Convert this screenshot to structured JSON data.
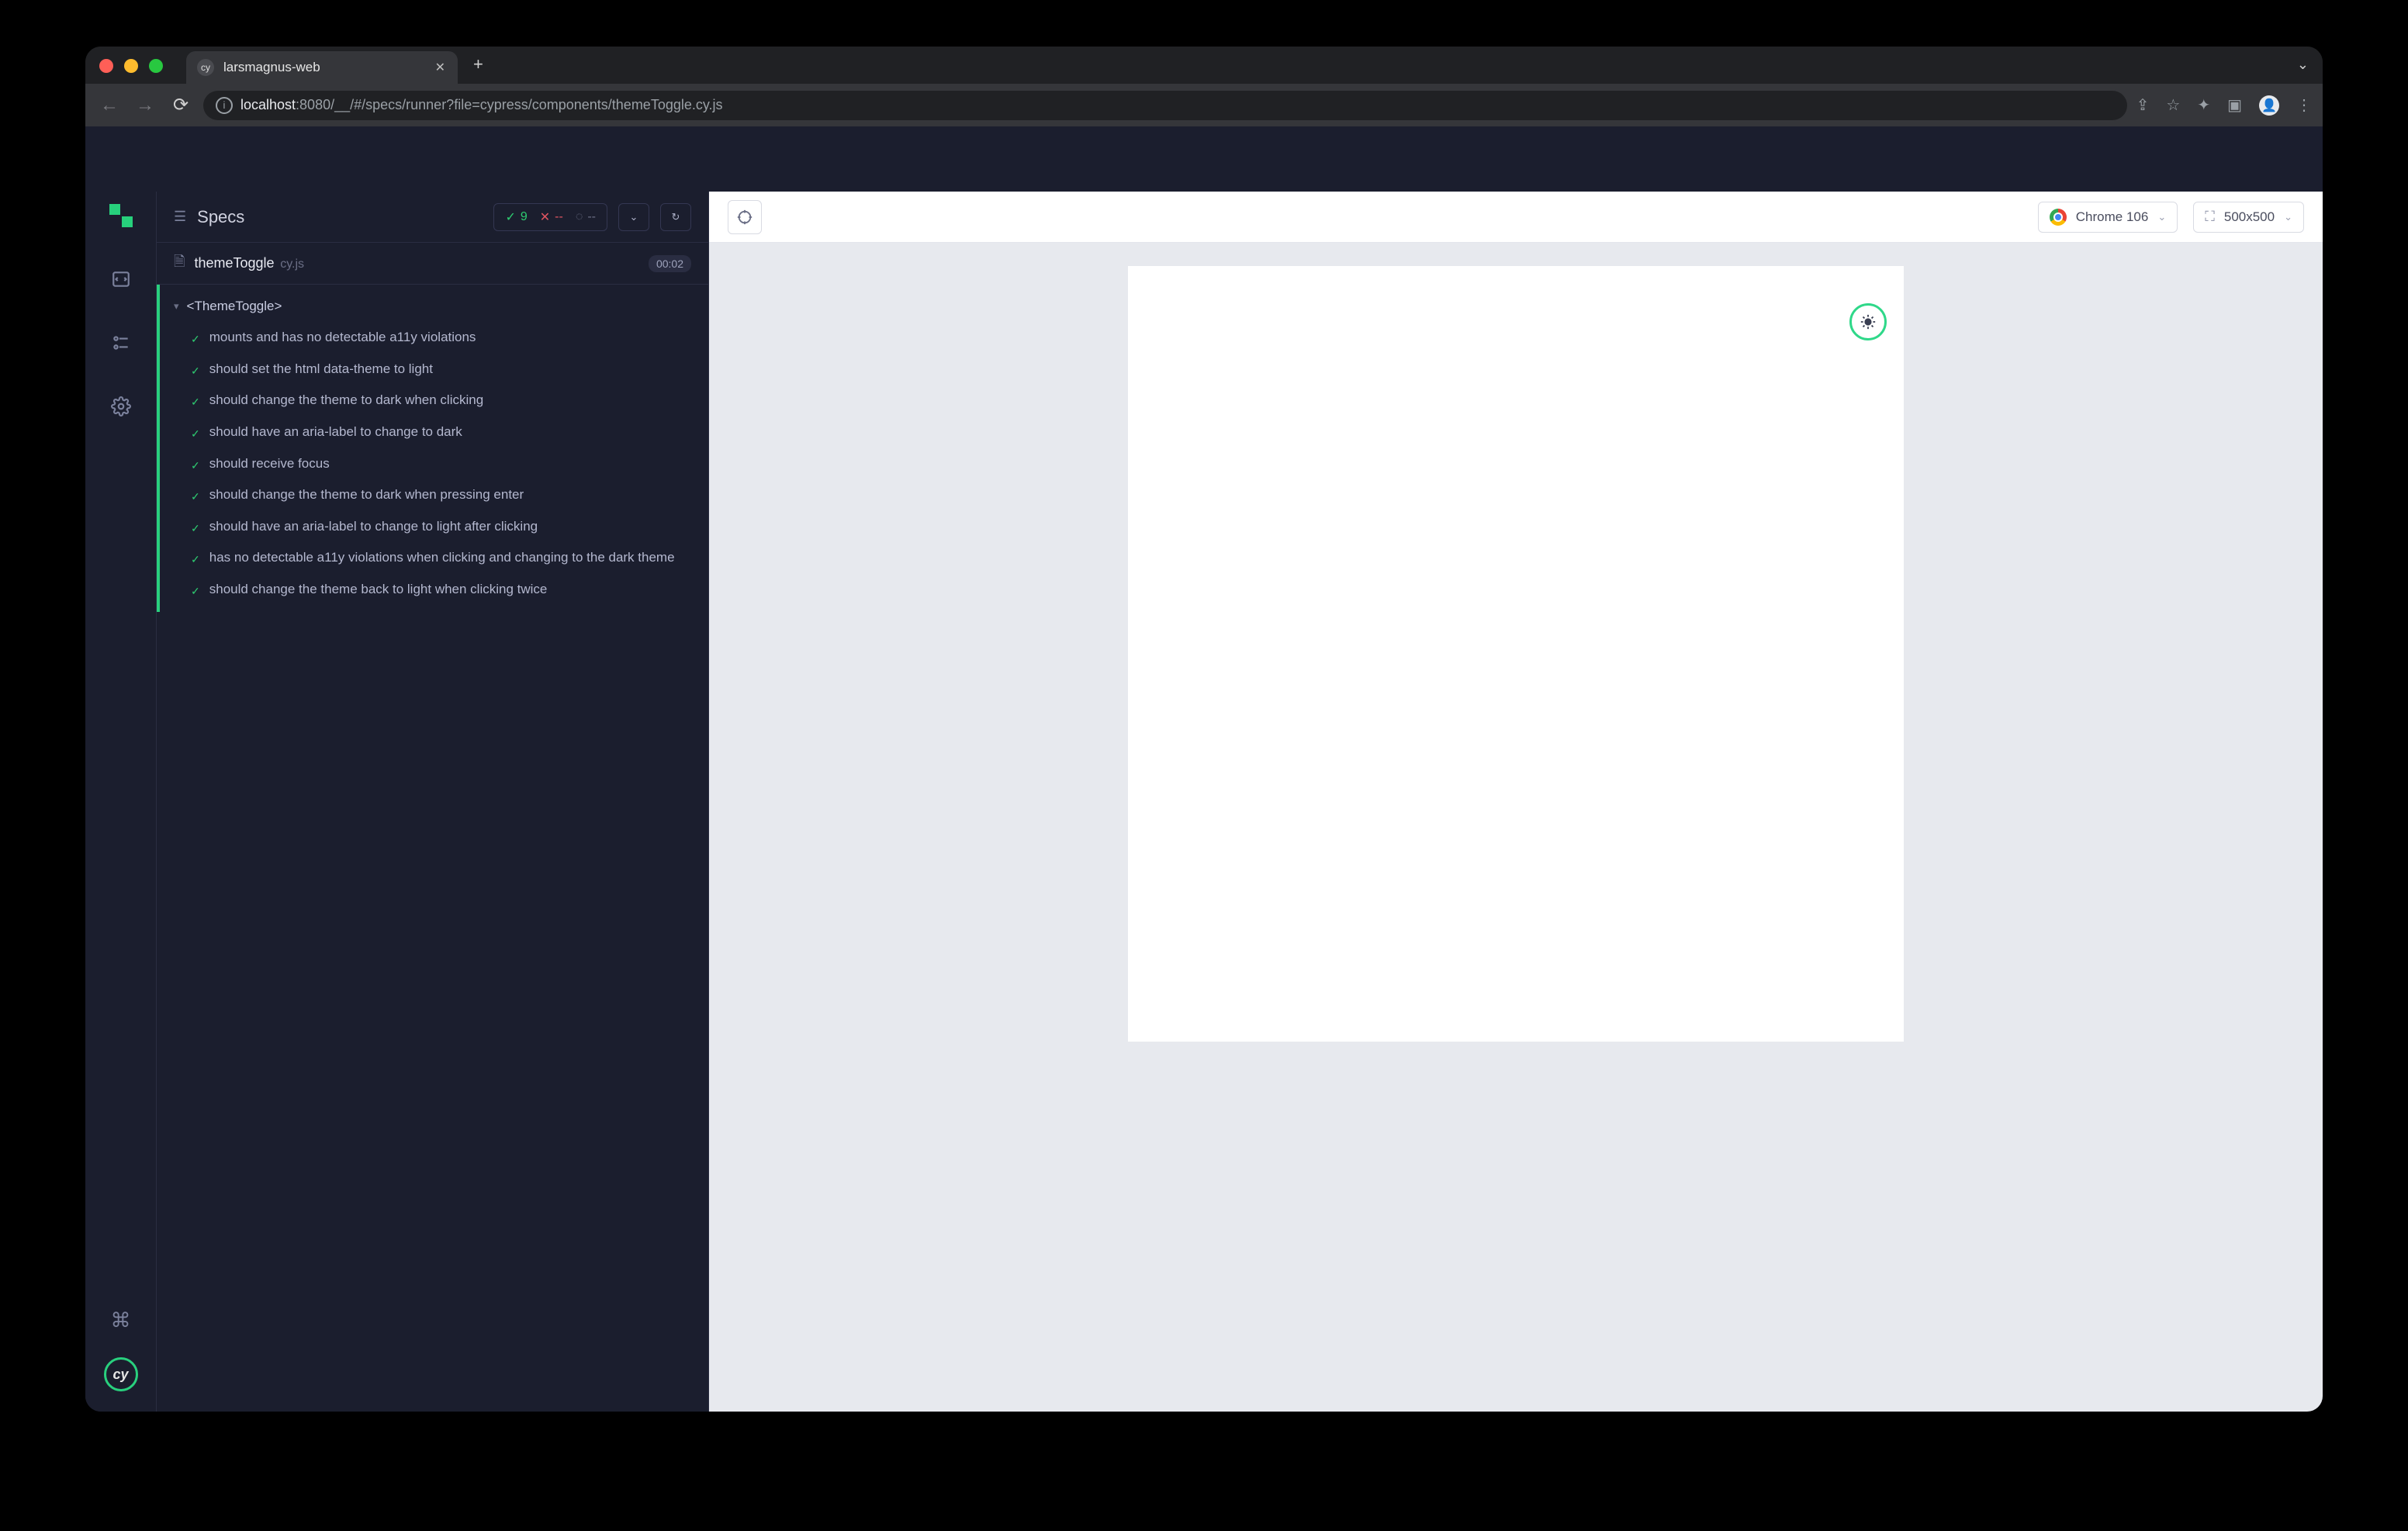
{
  "browser": {
    "tab_title": "larsmagnus-web",
    "url_host": "localhost",
    "url_port": ":8080",
    "url_path": "/__/#/specs/runner?file=cypress/components/themeToggle.cy.js"
  },
  "reporter": {
    "title": "Specs",
    "stats": {
      "passed": "9",
      "failed": "--",
      "pending": "--"
    },
    "spec_file": {
      "name": "themeToggle",
      "ext": "cy.js",
      "duration": "00:02"
    },
    "describe": "<ThemeToggle>",
    "tests": [
      "mounts and has no detectable a11y violations",
      "should set the html data-theme to light",
      "should change the theme to dark when clicking",
      "should have an aria-label to change to dark",
      "should receive focus",
      "should change the theme to dark when pressing enter",
      "should have an aria-label to change to light after clicking",
      "has no detectable a11y violations when clicking and changing to the dark theme",
      "should change the theme back to light when clicking twice"
    ]
  },
  "aut": {
    "browser_label": "Chrome 106",
    "viewport_label": "500x500"
  }
}
